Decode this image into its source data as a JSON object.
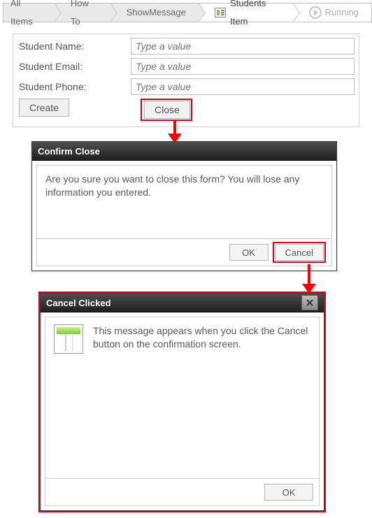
{
  "breadcrumb": {
    "items": [
      {
        "label": "All Items"
      },
      {
        "label": "How To"
      },
      {
        "label": "ShowMessage"
      },
      {
        "label": "Students Item"
      },
      {
        "label": "Running"
      }
    ]
  },
  "form": {
    "name_label": "Student Name:",
    "email_label": "Student Email:",
    "phone_label": "Student Phone:",
    "placeholder": "Type a value",
    "create_label": "Create",
    "close_label": "Close"
  },
  "dialog1": {
    "title": "Confirm Close",
    "body": "Are you sure you want to close this form? You will lose any information you entered.",
    "ok_label": "OK",
    "cancel_label": "Cancel"
  },
  "dialog2": {
    "title": "Cancel Clicked",
    "body": "This message appears when you click the Cancel button on the confirmation screen.",
    "ok_label": "OK"
  }
}
